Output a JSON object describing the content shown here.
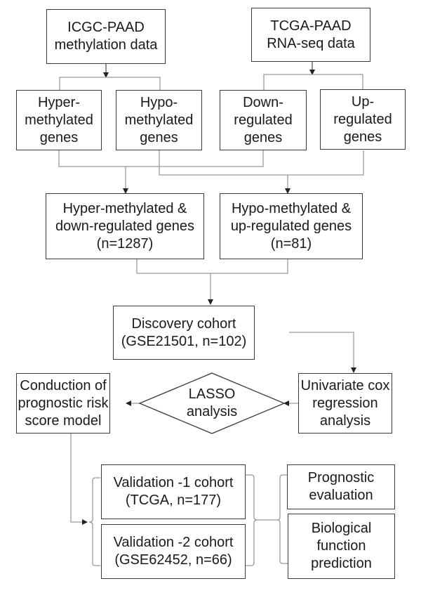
{
  "diagram": {
    "type": "flowchart",
    "nodes": {
      "icgc": "ICGC-PAAD\nmethylation data",
      "tcga": "TCGA-PAAD\nRNA-seq data",
      "hyper": "Hyper-\nmethylated\ngenes",
      "hypo": "Hypo-\nmethylated\ngenes",
      "down": "Down-\nregulated\ngenes",
      "up": "Up-\nregulated\ngenes",
      "hyper_down": "Hyper-methylated &\ndown-regulated genes\n(n=1287)",
      "hypo_up": "Hypo-methylated &\nup-regulated genes\n(n=81)",
      "discovery": "Discovery cohort\n(GSE21501, n=102)",
      "univariate": "Univariate cox\nregression\nanalysis",
      "lasso": "LASSO\nanalysis",
      "model": "Conduction of\nprognostic risk\nscore model",
      "validation1": "Validation -1 cohort\n(TCGA, n=177)",
      "validation2": "Validation -2 cohort\n(GSE62452, n=66)",
      "prognostic": "Prognostic\nevaluation",
      "biological": "Biological\nfunction\nprediction"
    },
    "edges": [
      {
        "from": "icgc",
        "to": [
          "hyper",
          "hypo"
        ]
      },
      {
        "from": "tcga",
        "to": [
          "down",
          "up"
        ]
      },
      {
        "from": [
          "hyper",
          "down"
        ],
        "to": "hyper_down"
      },
      {
        "from": [
          "hypo",
          "up"
        ],
        "to": "hypo_up"
      },
      {
        "from": [
          "hyper_down",
          "hypo_up"
        ],
        "to": "discovery"
      },
      {
        "from": "discovery",
        "to": "univariate"
      },
      {
        "from": "univariate",
        "to": "lasso"
      },
      {
        "from": "lasso",
        "to": "model"
      },
      {
        "from": "model",
        "to": [
          "validation1",
          "validation2"
        ]
      },
      {
        "from": [
          "validation1",
          "validation2"
        ],
        "to": [
          "prognostic",
          "biological"
        ]
      }
    ]
  }
}
